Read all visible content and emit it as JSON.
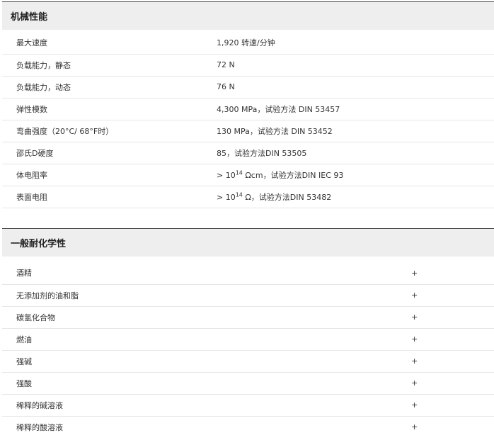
{
  "mechanical": {
    "title": "机械性能",
    "rows": [
      {
        "label": "最大速度",
        "value": "1,920 转速/分钟"
      },
      {
        "label": "负载能力，静态",
        "value": "72 N"
      },
      {
        "label": "负载能力，动态",
        "value": "76 N"
      },
      {
        "label": "弹性模数",
        "value": "4,300 MPa，试验方法 DIN 53457"
      },
      {
        "label": "弯曲强度（20°C/ 68°F时）",
        "value": "130 MPa，试验方法 DIN 53452"
      },
      {
        "label": "邵氏D硬度",
        "value": "85，试验方法DIN 53505"
      },
      {
        "label": "体电阻率",
        "value_prefix": "> 10",
        "value_exp": "14",
        "value_suffix": " Ωcm，试验方法DIN IEC 93"
      },
      {
        "label": "表面电阻",
        "value_prefix": "> 10",
        "value_exp": "14",
        "value_suffix": " Ω，试验方法DIN 53482"
      }
    ]
  },
  "chemical": {
    "title": "一般耐化学性",
    "rows": [
      {
        "label": "酒精",
        "value": "+"
      },
      {
        "label": "无添加剂的油和脂",
        "value": "+"
      },
      {
        "label": "碳氢化合物",
        "value": "+"
      },
      {
        "label": "燃油",
        "value": "+"
      },
      {
        "label": "强碱",
        "value": "+"
      },
      {
        "label": "强酸",
        "value": "+"
      },
      {
        "label": "稀释的碱溶液",
        "value": "+"
      },
      {
        "label": "稀释的酸溶液",
        "value": "+"
      }
    ]
  }
}
